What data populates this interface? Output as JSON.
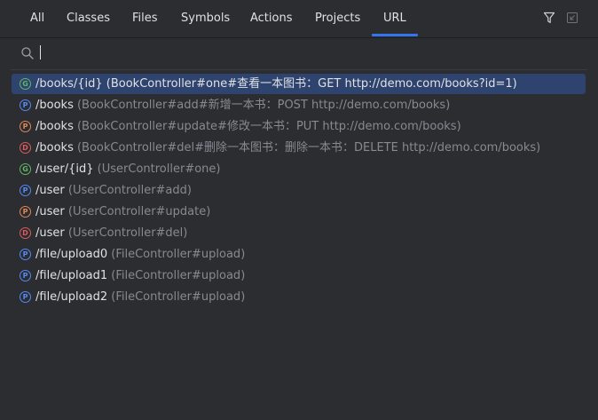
{
  "tabs": [
    {
      "label": "All",
      "active": false
    },
    {
      "label": "Classes",
      "active": false
    },
    {
      "label": "Files",
      "active": false
    },
    {
      "label": "Symbols",
      "active": false
    },
    {
      "label": "Actions",
      "active": false
    },
    {
      "label": "Projects",
      "active": false
    },
    {
      "label": "URL",
      "active": true
    }
  ],
  "toolbar": {
    "filter_icon": "filter-icon",
    "pin_icon": "open-in-window-icon"
  },
  "search": {
    "value": "",
    "placeholder": "",
    "icon": "search-icon"
  },
  "results": [
    {
      "method": "G",
      "path": "/books/{id}",
      "detail": "(BookController#one#查看一本图书：GET http://demo.com/books?id=1)",
      "selected": true
    },
    {
      "method": "P",
      "path": "/books",
      "detail": "(BookController#add#新增一本书：POST http://demo.com/books)",
      "selected": false
    },
    {
      "method": "P",
      "path": "/books",
      "detail": "(BookController#update#修改一本书：PUT http://demo.com/books)",
      "selected": false
    },
    {
      "method": "D",
      "path": "/books",
      "detail": "(BookController#del#删除一本图书：删除一本书：DELETE http://demo.com/books)",
      "selected": false
    },
    {
      "method": "G",
      "path": "/user/{id}",
      "detail": "(UserController#one)",
      "selected": false
    },
    {
      "method": "P",
      "path": "/user",
      "detail": "(UserController#add)",
      "selected": false
    },
    {
      "method": "P",
      "path": "/user",
      "detail": "(UserController#update)",
      "selected": false
    },
    {
      "method": "D",
      "path": "/user",
      "detail": "(UserController#del)",
      "selected": false
    },
    {
      "method": "P",
      "path": "/file/upload0",
      "detail": "(FileController#upload)",
      "selected": false
    },
    {
      "method": "P",
      "path": "/file/upload1",
      "detail": "(FileController#upload)",
      "selected": false
    },
    {
      "method": "P",
      "path": "/file/upload2",
      "detail": "(FileController#upload)",
      "selected": false
    }
  ],
  "colors": {
    "background": "#2b2d30",
    "selection": "#2e436e",
    "accent": "#3574f0",
    "get": "#5fb865",
    "post": "#548af7",
    "put": "#e08855",
    "delete": "#db5c5c"
  }
}
